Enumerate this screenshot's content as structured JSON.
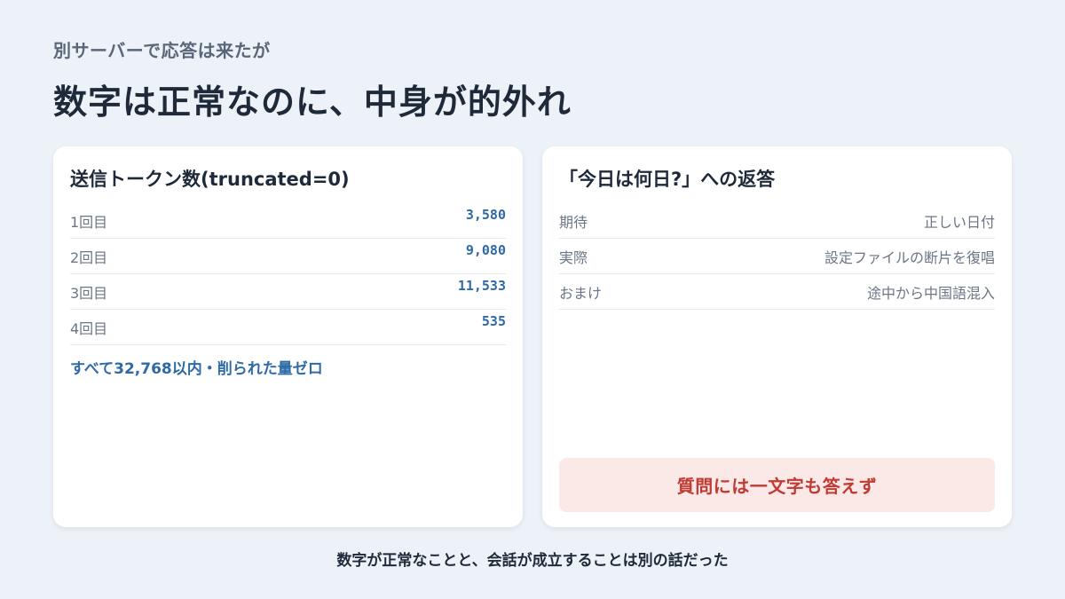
{
  "header": {
    "subtitle": "別サーバーで応答は来たが",
    "title": "数字は正常なのに、中身が的外れ"
  },
  "left_card": {
    "title": "送信トークン数(truncated=0)",
    "rows": [
      {
        "label": "1回目",
        "value": "3,580"
      },
      {
        "label": "2回目",
        "value": "9,080"
      },
      {
        "label": "3回目",
        "value": "11,533"
      },
      {
        "label": "4回目",
        "value": "535"
      }
    ],
    "note": "すべて32,768以内・削られた量ゼロ"
  },
  "right_card": {
    "title": "「今日は何日?」への返答",
    "rows": [
      {
        "label": "期待",
        "value": "正しい日付"
      },
      {
        "label": "実際",
        "value": "設定ファイルの断片を復唱"
      },
      {
        "label": "おまけ",
        "value": "途中から中国語混入"
      }
    ],
    "alert": "質問には一文字も答えず"
  },
  "footer": {
    "text": "数字が正常なことと、会話が成立することは別の話だった"
  },
  "colors": {
    "background": "#edf1f8",
    "accent_blue": "#2e6aa5",
    "alert_red": "#bf3b33",
    "alert_bg": "#fbe9e8"
  }
}
